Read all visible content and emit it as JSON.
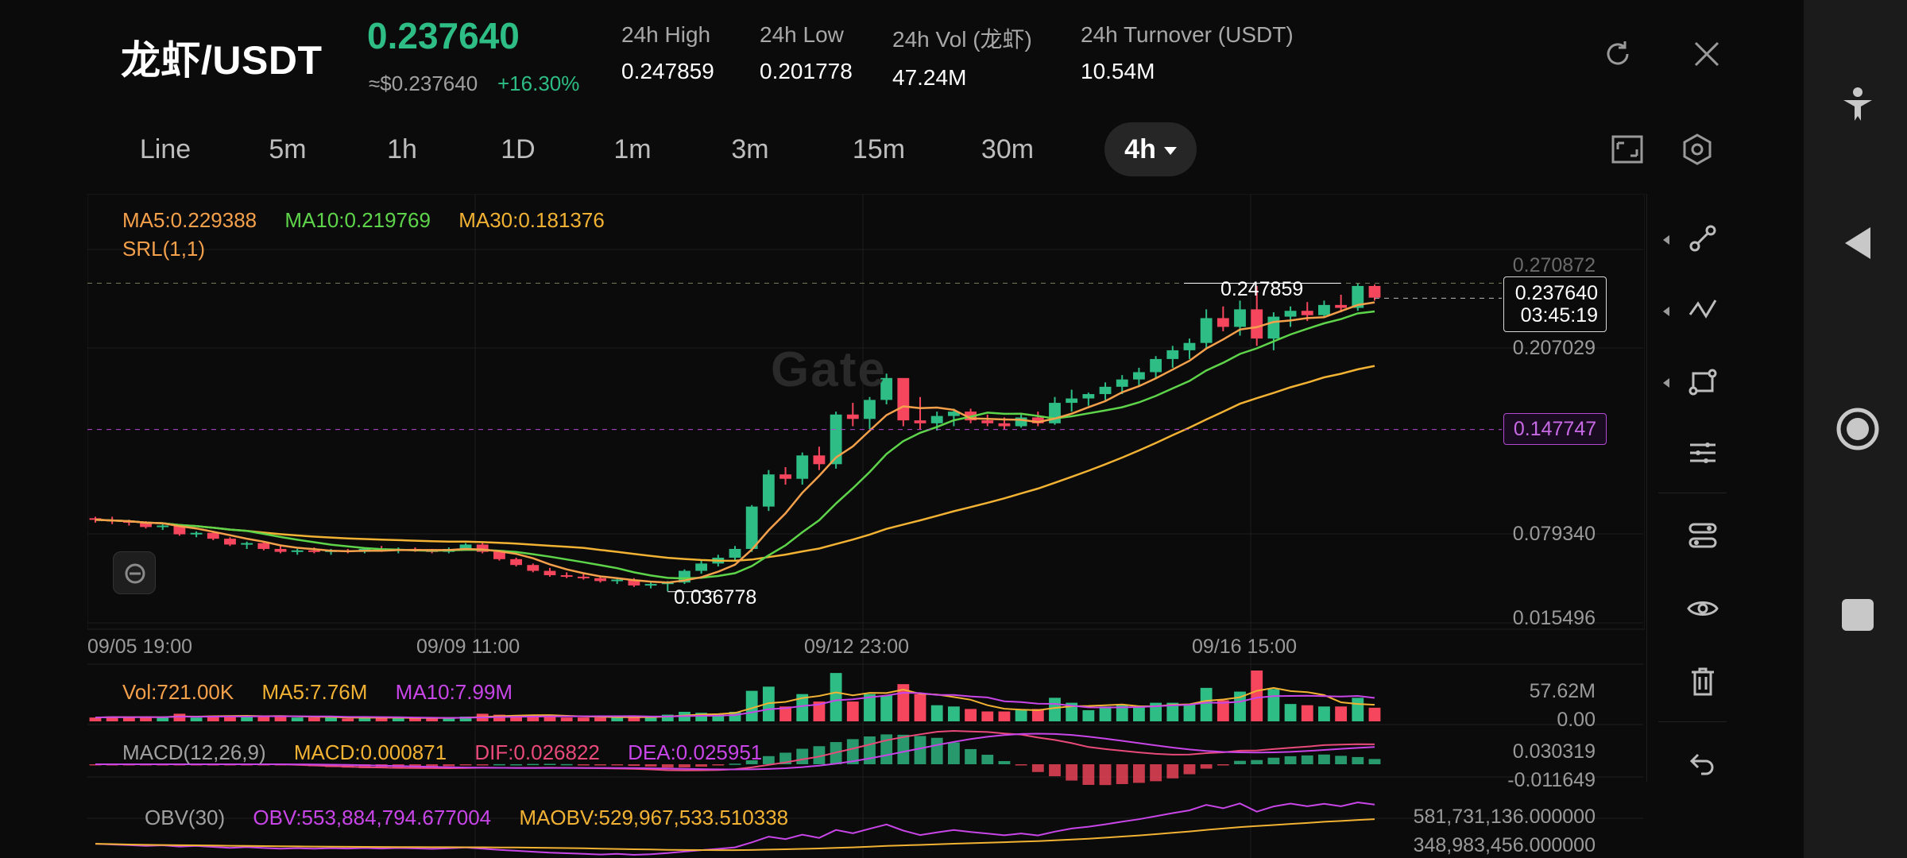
{
  "header": {
    "pair": "龙虾/USDT",
    "last_price": "0.237640",
    "approx_price": "≈$0.237640",
    "change_pct": "+16.30%",
    "stats": [
      {
        "label": "24h   High",
        "value": "0.247859"
      },
      {
        "label": "24h   Low",
        "value": "0.201778"
      },
      {
        "label": "24h   Vol (龙虾)",
        "value": "47.24M"
      },
      {
        "label": "24h   Turnover (USDT)",
        "value": "10.54M"
      }
    ],
    "icons": [
      "refresh-icon",
      "close-icon"
    ]
  },
  "tabs": [
    {
      "label": "Line"
    },
    {
      "label": "5m"
    },
    {
      "label": "1h"
    },
    {
      "label": "1D"
    },
    {
      "label": "1m"
    },
    {
      "label": "3m"
    },
    {
      "label": "15m"
    },
    {
      "label": "30m"
    },
    {
      "label": "4h",
      "active": true
    }
  ],
  "toolbar_icons": [
    "fullscreen-icon",
    "settings-icon"
  ],
  "watermark": "Gate",
  "colors": {
    "up": "#2ebd85",
    "down": "#f6465d",
    "ma5": "#f5a04b",
    "ma10": "#5ed44a",
    "ma30": "#f2b233",
    "srl": "#b348d2",
    "vol": "#f5a04b",
    "vol_ma5": "#f2b233",
    "vol_ma10": "#c845e8",
    "macd_dif": "#e84a7a",
    "macd_dea": "#c845e8",
    "obv": "#c845e8",
    "maobv": "#f2b233"
  },
  "legends": {
    "main": {
      "ma5": "MA5:0.229388",
      "ma10": "MA10:0.219769",
      "ma30": "MA30:0.181376",
      "srl": "SRL(1,1)"
    },
    "volume": {
      "vol": "Vol:721.00K",
      "ma5": "MA5:7.76M",
      "ma10": "MA10:7.99M"
    },
    "macd": {
      "name": "MACD(12,26,9)",
      "macd": "MACD:0.000871",
      "dif": "DIF:0.026822",
      "dea": "DEA:0.025951"
    },
    "obv": {
      "name": "OBV(30)",
      "obv": "OBV:553,884,794.677004",
      "maobv": "MAOBV:529,967,533.510338"
    }
  },
  "axis": {
    "main_y": [
      "0.207029",
      "0.079340",
      "0.015496"
    ],
    "main_y_partial": "0.270872",
    "x": [
      "09/05 19:00",
      "09/09 11:00",
      "09/12 23:00",
      "09/16 15:00"
    ],
    "vol_y": [
      "57.62M",
      "0.00"
    ],
    "macd_y": [
      "0.030319",
      "-0.011649"
    ],
    "obv_y": [
      "581,731,136.000000",
      "348,983,456.000000"
    ]
  },
  "annotations": {
    "high": "0.247859",
    "low": "0.036778",
    "price_tag": {
      "price": "0.237640",
      "countdown": "03:45:19"
    },
    "srl_tag": "0.147747"
  },
  "chart_data": {
    "type": "candlestick",
    "timeframe": "4h",
    "x_ticks": [
      "09/05 19:00",
      "09/09 11:00",
      "09/12 23:00",
      "09/16 15:00"
    ],
    "ylim": [
      0.0154,
      0.271
    ],
    "candles": [
      [
        0.087,
        0.088,
        0.084,
        0.086
      ],
      [
        0.086,
        0.088,
        0.083,
        0.085
      ],
      [
        0.085,
        0.086,
        0.082,
        0.084
      ],
      [
        0.084,
        0.085,
        0.08,
        0.081
      ],
      [
        0.081,
        0.083,
        0.079,
        0.082
      ],
      [
        0.082,
        0.083,
        0.075,
        0.076
      ],
      [
        0.076,
        0.078,
        0.074,
        0.077
      ],
      [
        0.077,
        0.078,
        0.072,
        0.073
      ],
      [
        0.073,
        0.074,
        0.068,
        0.069
      ],
      [
        0.069,
        0.071,
        0.066,
        0.07
      ],
      [
        0.07,
        0.071,
        0.065,
        0.066
      ],
      [
        0.066,
        0.068,
        0.063,
        0.064
      ],
      [
        0.064,
        0.066,
        0.062,
        0.065
      ],
      [
        0.065,
        0.067,
        0.063,
        0.064
      ],
      [
        0.064,
        0.066,
        0.062,
        0.065
      ],
      [
        0.065,
        0.066,
        0.063,
        0.064
      ],
      [
        0.064,
        0.067,
        0.063,
        0.066
      ],
      [
        0.066,
        0.068,
        0.064,
        0.065
      ],
      [
        0.065,
        0.067,
        0.063,
        0.066
      ],
      [
        0.066,
        0.067,
        0.064,
        0.065
      ],
      [
        0.065,
        0.066,
        0.063,
        0.064
      ],
      [
        0.064,
        0.067,
        0.063,
        0.066
      ],
      [
        0.066,
        0.07,
        0.065,
        0.069
      ],
      [
        0.069,
        0.071,
        0.063,
        0.064
      ],
      [
        0.064,
        0.065,
        0.058,
        0.059
      ],
      [
        0.059,
        0.06,
        0.054,
        0.055
      ],
      [
        0.055,
        0.056,
        0.05,
        0.051
      ],
      [
        0.051,
        0.053,
        0.047,
        0.048
      ],
      [
        0.048,
        0.05,
        0.046,
        0.047
      ],
      [
        0.047,
        0.049,
        0.045,
        0.046
      ],
      [
        0.046,
        0.047,
        0.043,
        0.044
      ],
      [
        0.044,
        0.046,
        0.042,
        0.045
      ],
      [
        0.045,
        0.046,
        0.04,
        0.041
      ],
      [
        0.041,
        0.043,
        0.039,
        0.042
      ],
      [
        0.042,
        0.044,
        0.037,
        0.043
      ],
      [
        0.043,
        0.052,
        0.042,
        0.051
      ],
      [
        0.051,
        0.058,
        0.049,
        0.056
      ],
      [
        0.056,
        0.062,
        0.054,
        0.06
      ],
      [
        0.06,
        0.068,
        0.058,
        0.066
      ],
      [
        0.066,
        0.096,
        0.064,
        0.095
      ],
      [
        0.095,
        0.12,
        0.092,
        0.117
      ],
      [
        0.117,
        0.122,
        0.11,
        0.114
      ],
      [
        0.114,
        0.132,
        0.11,
        0.13
      ],
      [
        0.13,
        0.136,
        0.12,
        0.124
      ],
      [
        0.124,
        0.16,
        0.121,
        0.158
      ],
      [
        0.158,
        0.166,
        0.15,
        0.155
      ],
      [
        0.155,
        0.17,
        0.148,
        0.168
      ],
      [
        0.168,
        0.186,
        0.165,
        0.183
      ],
      [
        0.183,
        0.18,
        0.15,
        0.154
      ],
      [
        0.154,
        0.17,
        0.148,
        0.152
      ],
      [
        0.152,
        0.16,
        0.147,
        0.157
      ],
      [
        0.157,
        0.162,
        0.15,
        0.16
      ],
      [
        0.16,
        0.162,
        0.152,
        0.154
      ],
      [
        0.154,
        0.158,
        0.15,
        0.152
      ],
      [
        0.152,
        0.156,
        0.148,
        0.15
      ],
      [
        0.15,
        0.158,
        0.149,
        0.156
      ],
      [
        0.156,
        0.16,
        0.15,
        0.152
      ],
      [
        0.152,
        0.17,
        0.151,
        0.166
      ],
      [
        0.166,
        0.175,
        0.16,
        0.169
      ],
      [
        0.169,
        0.173,
        0.164,
        0.172
      ],
      [
        0.172,
        0.18,
        0.168,
        0.177
      ],
      [
        0.177,
        0.185,
        0.172,
        0.182
      ],
      [
        0.182,
        0.19,
        0.178,
        0.187
      ],
      [
        0.187,
        0.198,
        0.183,
        0.196
      ],
      [
        0.196,
        0.205,
        0.19,
        0.202
      ],
      [
        0.202,
        0.21,
        0.196,
        0.207
      ],
      [
        0.207,
        0.23,
        0.203,
        0.224
      ],
      [
        0.224,
        0.232,
        0.215,
        0.218
      ],
      [
        0.218,
        0.236,
        0.212,
        0.23
      ],
      [
        0.23,
        0.246,
        0.205,
        0.21
      ],
      [
        0.21,
        0.228,
        0.202,
        0.225
      ],
      [
        0.225,
        0.232,
        0.218,
        0.229
      ],
      [
        0.229,
        0.235,
        0.222,
        0.226
      ],
      [
        0.226,
        0.236,
        0.224,
        0.233
      ],
      [
        0.233,
        0.24,
        0.228,
        0.231
      ],
      [
        0.231,
        0.248,
        0.229,
        0.246
      ],
      [
        0.246,
        0.247,
        0.236,
        0.238
      ]
    ]
  }
}
